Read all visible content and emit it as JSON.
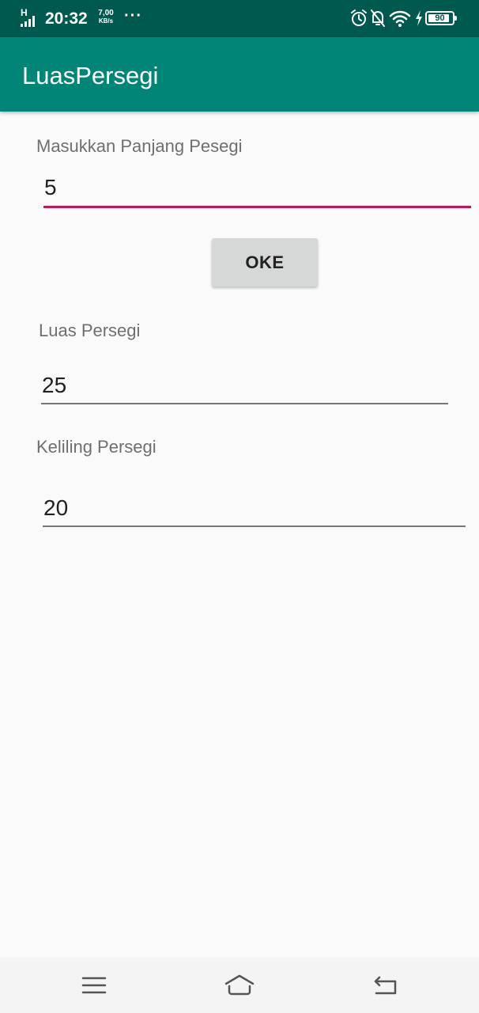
{
  "status_bar": {
    "network_type": "H",
    "time": "20:32",
    "speed_value": "7,00",
    "speed_unit": "KB/s",
    "more": "···",
    "battery_level": "90",
    "icons": [
      "signal-icon",
      "alarm-icon",
      "notifications-off-icon",
      "wifi-icon",
      "charging-icon",
      "battery-icon"
    ]
  },
  "app_bar": {
    "title": "LuasPersegi"
  },
  "form": {
    "input_label": "Masukkan Panjang Pesegi",
    "input_value": "5",
    "button_label": "OKE",
    "area_label": "Luas Persegi",
    "area_value": "25",
    "perimeter_label": "Keliling Persegi",
    "perimeter_value": "20"
  },
  "nav_bar": {
    "icons": [
      "menu-icon",
      "home-icon",
      "back-icon"
    ]
  },
  "colors": {
    "status_bar": "#00594f",
    "app_bar": "#008577",
    "accent": "#c2185b",
    "background": "#fafafa"
  }
}
